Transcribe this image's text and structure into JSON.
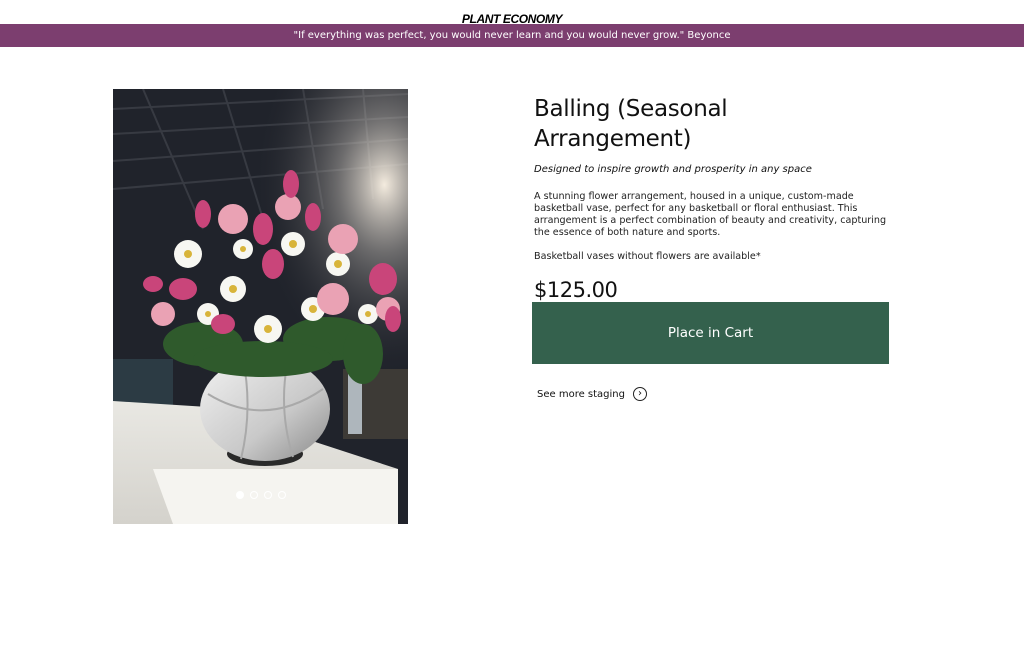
{
  "header": {
    "brand": "PLANT ECONOMY",
    "quote": "\"If everything was perfect, you would never learn and you would never grow.\" Beyonce"
  },
  "product": {
    "title": "Balling (Seasonal Arrangement)",
    "tagline": "Designed to inspire growth and prosperity in any space",
    "description": "A stunning flower arrangement, housed in a unique, custom-made basketball vase, perfect for any basketball or floral enthusiast. This arrangement is a perfect combination of beauty and creativity, capturing the essence of both nature and sports.",
    "note": "Basketball vases without flowers are available*",
    "price": "$125.00"
  },
  "actions": {
    "cart_label": "Place in Cart",
    "staging_label": "See more staging",
    "staging_icon": "chevron-right-circle-icon"
  },
  "gallery": {
    "slide_count": 4,
    "active_slide": 1
  },
  "colors": {
    "banner": "#7c3e6f",
    "cart_button": "#34614d"
  }
}
